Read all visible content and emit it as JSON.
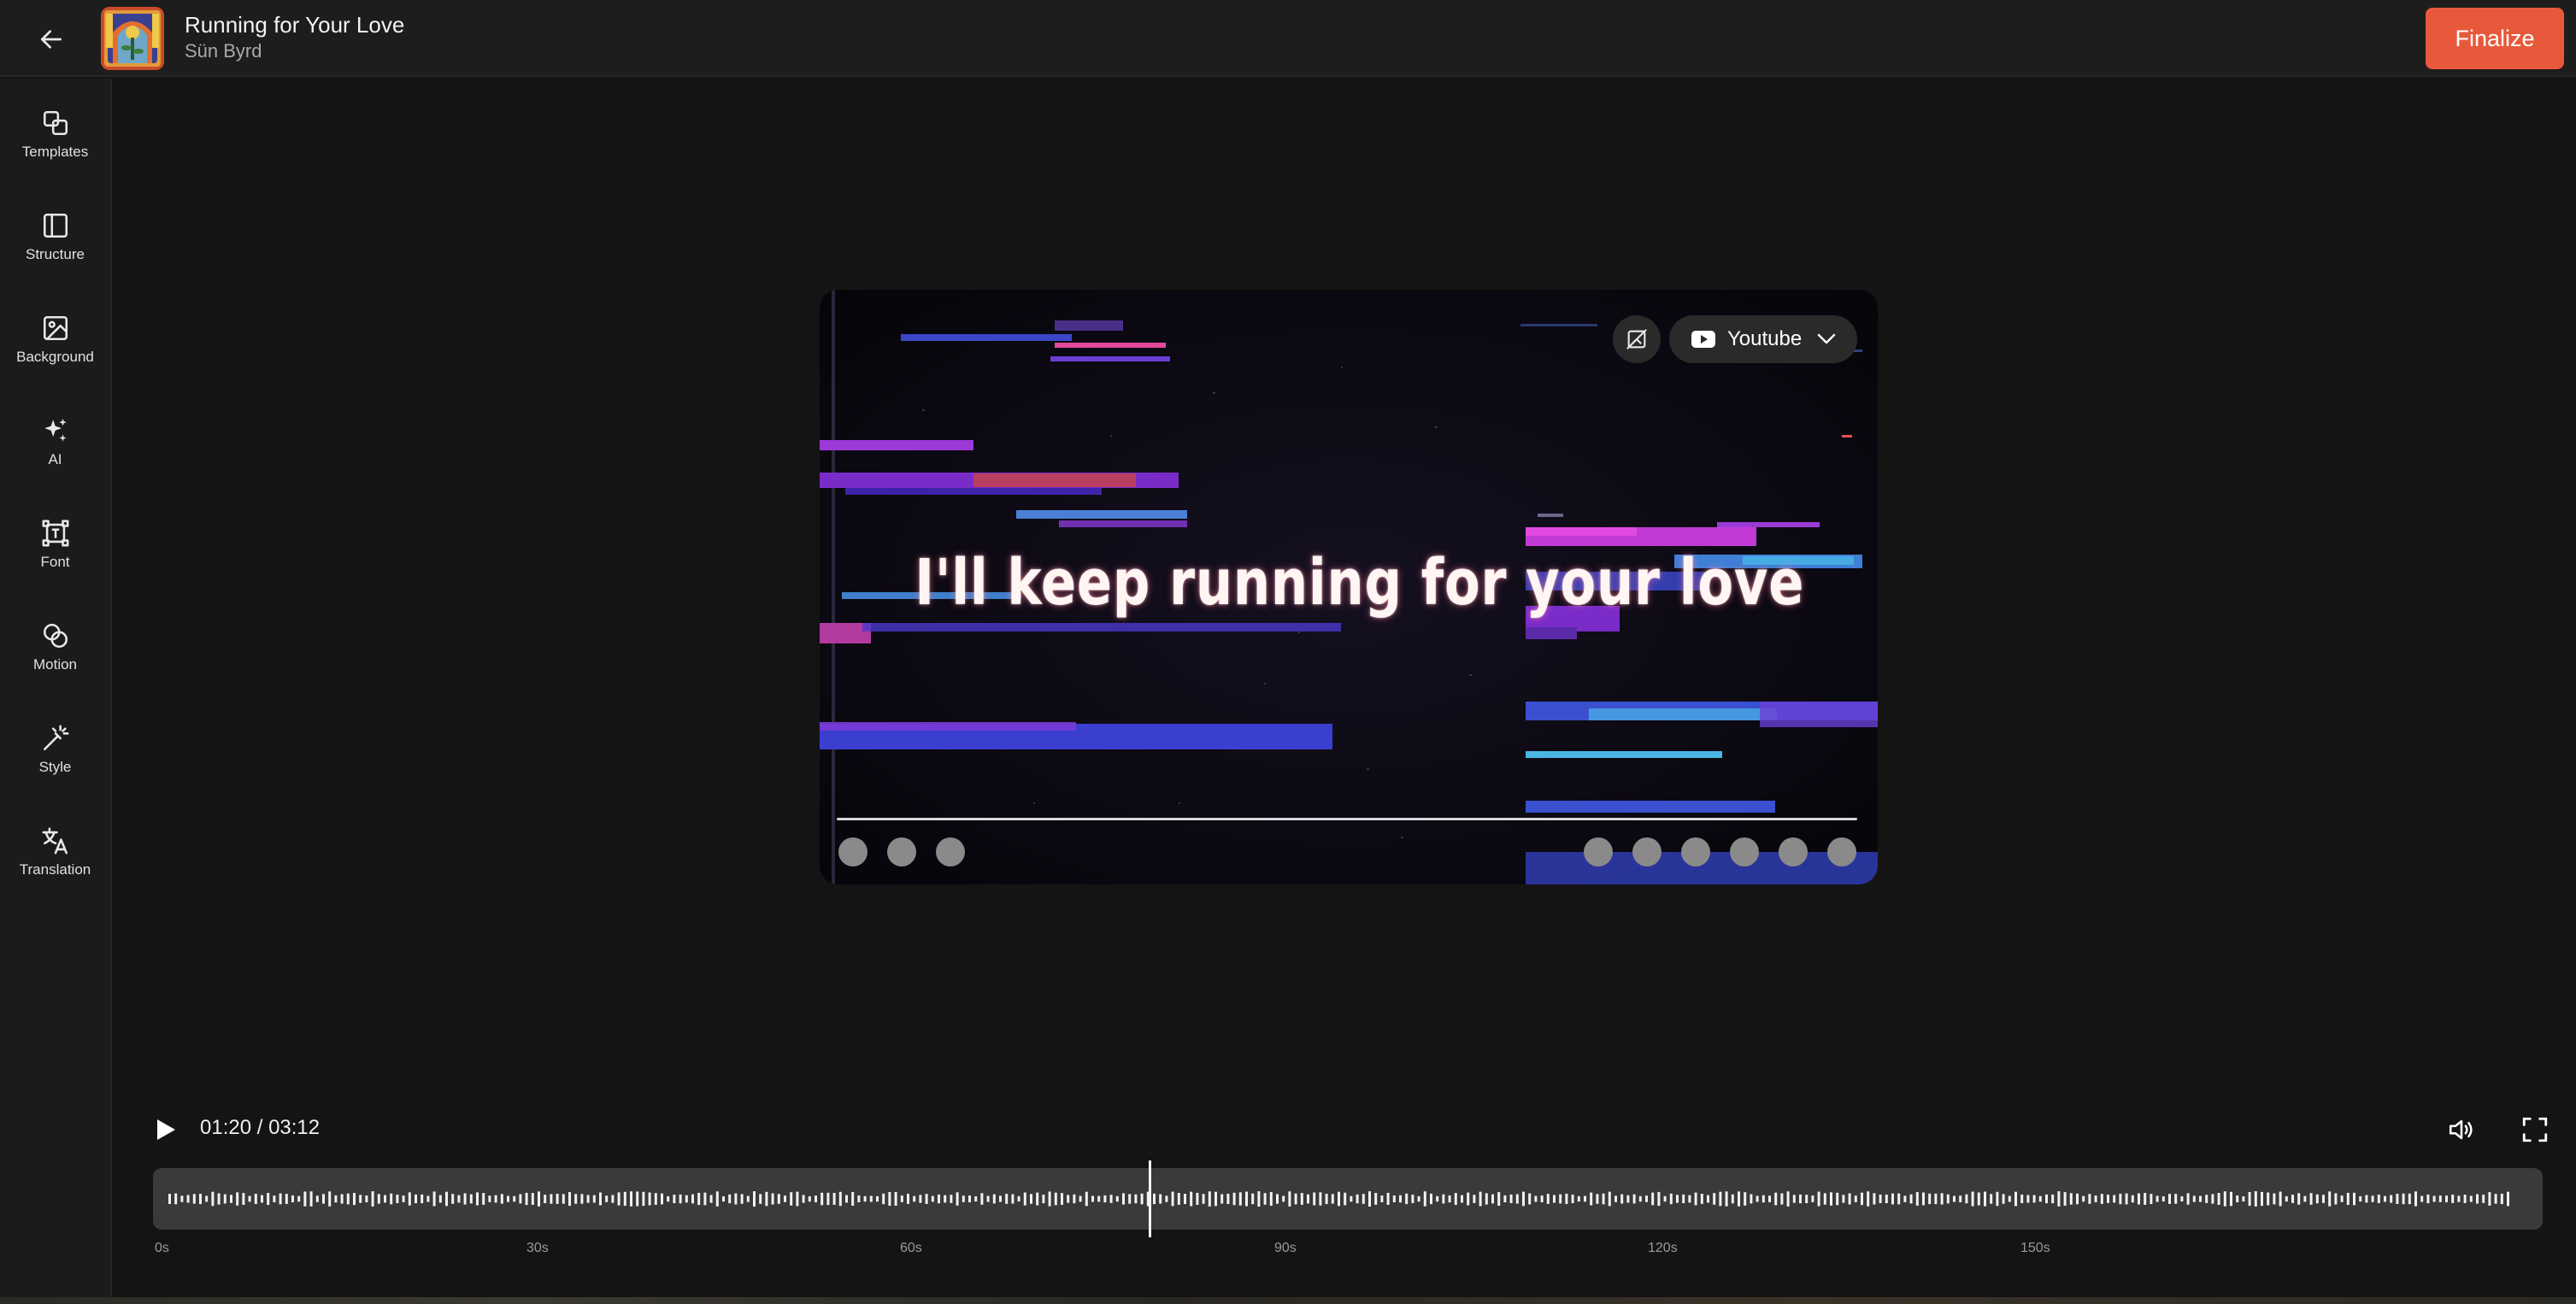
{
  "header": {
    "title": "Running for Your Love",
    "artist": "Sün Byrd",
    "finalize_label": "Finalize"
  },
  "sidebar": {
    "items": [
      {
        "label": "Templates",
        "icon": "templates-icon"
      },
      {
        "label": "Structure",
        "icon": "structure-icon"
      },
      {
        "label": "Background",
        "icon": "background-icon"
      },
      {
        "label": "AI",
        "icon": "ai-sparkle-icon"
      },
      {
        "label": "Font",
        "icon": "font-icon"
      },
      {
        "label": "Motion",
        "icon": "motion-icon"
      },
      {
        "label": "Style",
        "icon": "style-wand-icon"
      },
      {
        "label": "Translation",
        "icon": "translation-icon"
      }
    ]
  },
  "preview": {
    "lyric": "I'll keep running for your love",
    "platform_label": "Youtube"
  },
  "player": {
    "current_time": "01:20",
    "total_time": "03:12",
    "timecode": "01:20 / 03:12"
  },
  "timeline": {
    "ticks": [
      "0s",
      "30s",
      "60s",
      "90s",
      "120s",
      "150s"
    ]
  },
  "colors": {
    "accent": "#e8593c",
    "background": "#141414",
    "panel": "#1d1d1d"
  }
}
